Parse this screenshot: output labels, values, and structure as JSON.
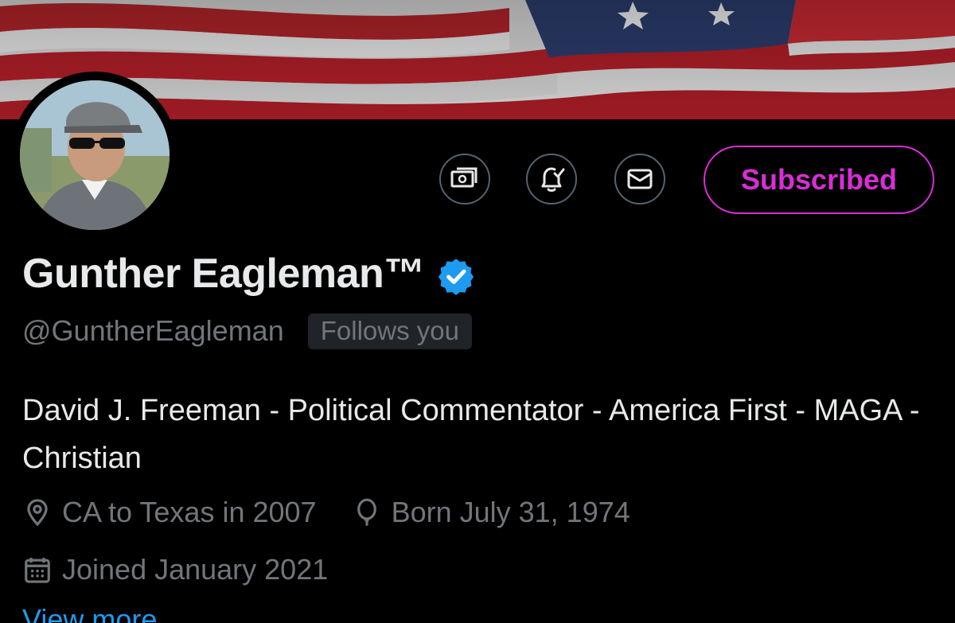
{
  "banner": {
    "description_icon": "american-flag-banner"
  },
  "profile": {
    "name": "Gunther Eagleman™",
    "handle": "@GuntherEagleman",
    "follows_badge": "Follows you",
    "bio": "David J. Freeman - Political Commentator - America First - MAGA - Christian",
    "location": "CA to Texas in 2007",
    "birthday": "Born July 31, 1974",
    "joined": "Joined January 2021",
    "view_more": "View more"
  },
  "actions": {
    "subscribe_label": "Subscribed",
    "icons": [
      "money-icon",
      "bell-check-icon",
      "mail-icon"
    ]
  },
  "colors": {
    "background": "#000000",
    "text_primary": "#e7e9ea",
    "text_secondary": "#71767b",
    "accent_subscribed": "#d92dd6",
    "verified_blue": "#1d9bf0",
    "link_blue": "#1d9bf0"
  }
}
